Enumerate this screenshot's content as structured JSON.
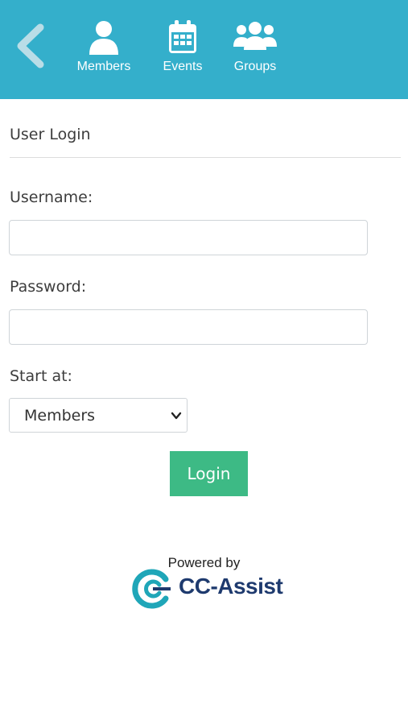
{
  "header": {
    "nav": [
      {
        "label": "Members",
        "icon": "user-icon"
      },
      {
        "label": "Events",
        "icon": "calendar-icon"
      },
      {
        "label": "Groups",
        "icon": "users-icon"
      }
    ],
    "back_icon": "chevron-left-icon",
    "background_color": "#34afcb"
  },
  "form": {
    "title": "User Login",
    "username_label": "Username:",
    "username_value": "",
    "password_label": "Password:",
    "password_value": "",
    "start_label": "Start at:",
    "start_selected": "Members",
    "login_label": "Login",
    "login_color": "#3dba85"
  },
  "footer": {
    "powered_by": "Powered by",
    "brand": "CC-Assist"
  }
}
